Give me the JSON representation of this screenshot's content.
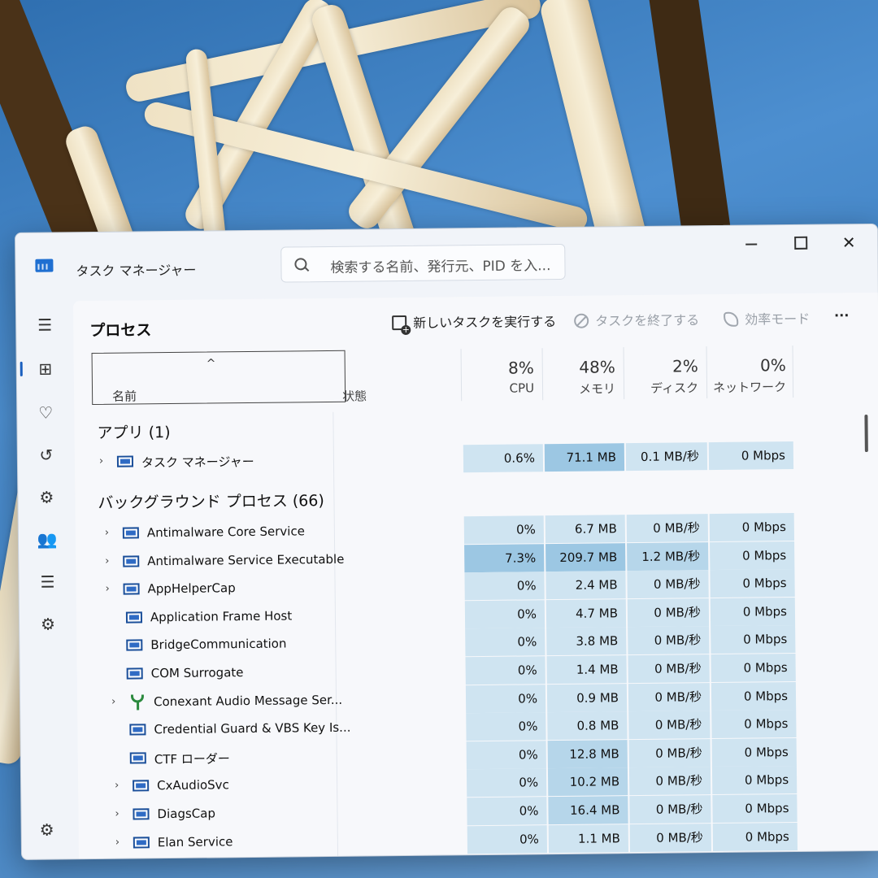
{
  "window": {
    "title": "タスク マネージャー",
    "search_placeholder": "検索する名前、発行元、PID を入..."
  },
  "nav": {
    "icons": [
      "hamburger-menu-icon",
      "processes-icon",
      "performance-icon",
      "app-history-icon",
      "startup-apps-icon",
      "users-icon",
      "details-icon",
      "services-icon",
      "settings-icon"
    ],
    "hamburger": "☰",
    "processes": "⊞",
    "performance": "♡",
    "app_history": "↺",
    "startup": "⚙",
    "users": "👥",
    "details": "☰",
    "services": "⚙",
    "settings": "⚙"
  },
  "toolbar": {
    "page_title": "プロセス",
    "run_new_task": "新しいタスクを実行する",
    "end_task": "タスクを終了する",
    "efficiency_mode": "効率モード",
    "more": "···"
  },
  "columns": {
    "name": "名前",
    "status": "状態",
    "cpu_pct": "8%",
    "cpu": "CPU",
    "memory_pct": "48%",
    "memory": "メモリ",
    "disk_pct": "2%",
    "disk": "ディスク",
    "network_pct": "0%",
    "network": "ネットワーク"
  },
  "groups": {
    "apps": "アプリ (1)",
    "background": "バックグラウンド プロセス (66)"
  },
  "apps": [
    {
      "name": "タスク マネージャー",
      "cpu": "0.6%",
      "mem": "71.1 MB",
      "disk": "0.1 MB/秒",
      "net": "0 Mbps",
      "expand": true
    }
  ],
  "processes": [
    {
      "name": "Antimalware Core Service",
      "cpu": "0%",
      "mem": "6.7 MB",
      "disk": "0 MB/秒",
      "net": "0 Mbps",
      "expand": true
    },
    {
      "name": "Antimalware Service Executable",
      "cpu": "7.3%",
      "mem": "209.7 MB",
      "disk": "1.2 MB/秒",
      "net": "0 Mbps",
      "expand": true
    },
    {
      "name": "AppHelperCap",
      "cpu": "0%",
      "mem": "2.4 MB",
      "disk": "0 MB/秒",
      "net": "0 Mbps",
      "expand": true
    },
    {
      "name": "Application Frame Host",
      "cpu": "0%",
      "mem": "4.7 MB",
      "disk": "0 MB/秒",
      "net": "0 Mbps",
      "expand": false
    },
    {
      "name": "BridgeCommunication",
      "cpu": "0%",
      "mem": "3.8 MB",
      "disk": "0 MB/秒",
      "net": "0 Mbps",
      "expand": false
    },
    {
      "name": "COM Surrogate",
      "cpu": "0%",
      "mem": "1.4 MB",
      "disk": "0 MB/秒",
      "net": "0 Mbps",
      "expand": false
    },
    {
      "name": "Conexant Audio Message Ser...",
      "cpu": "0%",
      "mem": "0.9 MB",
      "disk": "0 MB/秒",
      "net": "0 Mbps",
      "expand": true,
      "icon": "conexant"
    },
    {
      "name": "Credential Guard & VBS Key Is...",
      "cpu": "0%",
      "mem": "0.8 MB",
      "disk": "0 MB/秒",
      "net": "0 Mbps",
      "expand": false
    },
    {
      "name": "CTF ローダー",
      "cpu": "0%",
      "mem": "12.8 MB",
      "disk": "0 MB/秒",
      "net": "0 Mbps",
      "expand": false
    },
    {
      "name": "CxAudioSvc",
      "cpu": "0%",
      "mem": "10.2 MB",
      "disk": "0 MB/秒",
      "net": "0 Mbps",
      "expand": true
    },
    {
      "name": "DiagsCap",
      "cpu": "0%",
      "mem": "16.4 MB",
      "disk": "0 MB/秒",
      "net": "0 Mbps",
      "expand": true
    },
    {
      "name": "Elan Service",
      "cpu": "0%",
      "mem": "1.1 MB",
      "disk": "0 MB/秒",
      "net": "0 Mbps",
      "expand": true
    }
  ],
  "icons": {
    "window_minimize": "minimize-icon",
    "window_maximize": "maximize-icon",
    "window_close": "✕"
  }
}
